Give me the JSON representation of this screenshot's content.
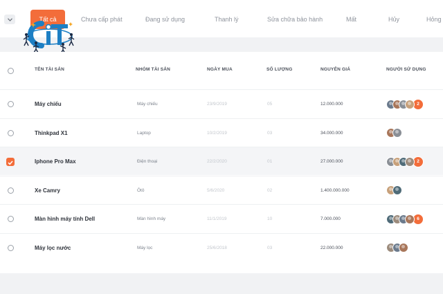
{
  "tabs": {
    "items": [
      {
        "label": "Tất cả",
        "active": true
      },
      {
        "label": "Chưa cấp phát"
      },
      {
        "label": "Đang sử dụng"
      },
      {
        "label": "Thanh lý"
      },
      {
        "label": "Sửa chữa bảo hành"
      },
      {
        "label": "Mất"
      },
      {
        "label": "Hủy"
      },
      {
        "label": "Hỏng"
      }
    ]
  },
  "logo": {
    "text": "CiT"
  },
  "table": {
    "columns": [
      "TÊN TÀI SẢN",
      "NHÓM TÀI SẢN",
      "NGÀY MUA",
      "SỐ LƯỢNG",
      "NGUYÊN GIÁ",
      "NGƯỜI SỬ DỤNG"
    ],
    "rows": [
      {
        "name": "Máy chiếu",
        "group": "Máy chiếu",
        "date": "23/9/2019",
        "qty": "05",
        "price": "12.000.000",
        "more": "2",
        "selected": false
      },
      {
        "name": "Thinkpad X1",
        "group": "Laptop",
        "date": "10/2/2019",
        "qty": "03",
        "price": "34.000.000",
        "more": "",
        "selected": false
      },
      {
        "name": "Iphone Pro Max",
        "group": "Điện thoại",
        "date": "22/2/2020",
        "qty": "01",
        "price": "27.000.000",
        "more": "2",
        "selected": true
      },
      {
        "name": "Xe Camry",
        "group": "Ôtô",
        "date": "5/6/2020",
        "qty": "02",
        "price": "1.400.000.000",
        "more": "",
        "selected": false
      },
      {
        "name": "Màn hình máy tính Dell",
        "group": "Màn hình máy",
        "date": "11/1/2019",
        "qty": "10",
        "price": "7.000.000",
        "more": "6",
        "selected": false
      },
      {
        "name": "Máy lọc nước",
        "group": "Máy lọc",
        "date": "25/6/2018",
        "qty": "03",
        "price": "22.000.000",
        "more": "",
        "selected": false
      }
    ]
  },
  "colors": {
    "accent": "#f36d3a",
    "avatars": [
      "#6b7a8c",
      "#a8765a",
      "#8a8f96",
      "#c7a07a",
      "#4f6b78",
      "#9c8b7c"
    ]
  }
}
